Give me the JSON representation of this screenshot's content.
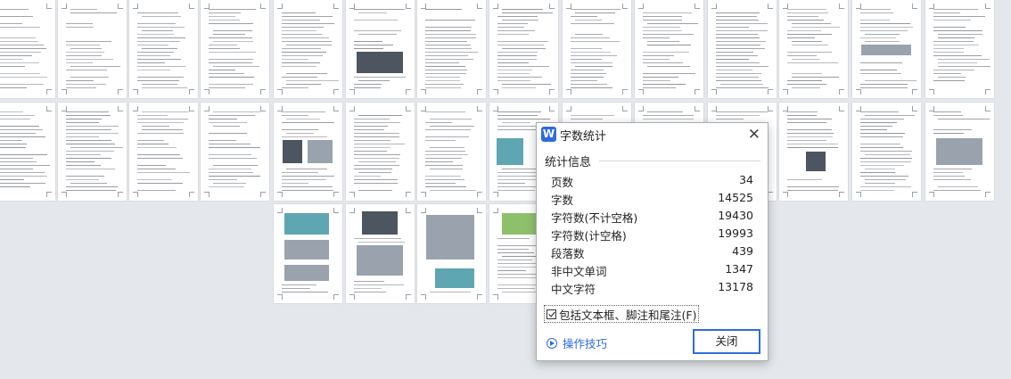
{
  "dialog": {
    "app_icon_letter": "W",
    "title": "字数统计",
    "close_glyph": "✕",
    "section_label": "统计信息",
    "stats": [
      {
        "label": "页数",
        "value": "34"
      },
      {
        "label": "字数",
        "value": "14525"
      },
      {
        "label": "字符数(不计空格)",
        "value": "19430"
      },
      {
        "label": "字符数(计空格)",
        "value": "19993"
      },
      {
        "label": "段落数",
        "value": "439"
      },
      {
        "label": "非中文单词",
        "value": "1347"
      },
      {
        "label": "中文字符",
        "value": "13178"
      }
    ],
    "include_checkbox_label": "包括文本框、脚注和尾注(F)",
    "include_checked": true,
    "tips_label": "操作技巧",
    "close_button_label": "关闭"
  },
  "icons": {
    "app": "wps-writer-icon",
    "close": "close-icon",
    "tips": "play-circle-icon",
    "checkbox": "checkbox-checked-icon"
  },
  "colors": {
    "background": "#e4e7eb",
    "accent": "#2f6cdc",
    "page": "#ffffff"
  },
  "document": {
    "page_count_visible": 34
  }
}
